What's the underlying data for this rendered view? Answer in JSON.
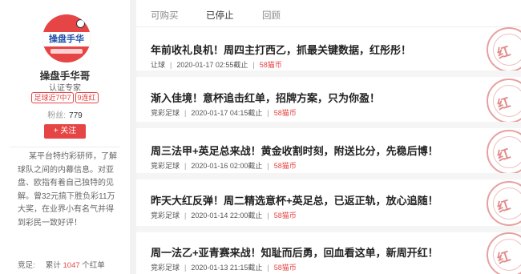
{
  "profile": {
    "avatar_text": "操盘手华",
    "name": "操盘手华哥",
    "cert": "认证专家",
    "tags": [
      "足球近7中7",
      "9连红"
    ],
    "fans_label": "粉丝:",
    "fans_count": "779",
    "follow_label": "+ 关注",
    "description": "某平台特约彩研师，了解球队之间的内幕信息。对亚盘、欧指有着自己独特的见解。曾32元搞下胜负彩11万大奖，在业界小有名气并得到彩民一致好评！",
    "result_label": "竞足:",
    "result_prefix": "累计",
    "result_count": "1047",
    "result_suffix": "个红单"
  },
  "tabs": [
    {
      "label": "可购买",
      "active": false
    },
    {
      "label": "已停止",
      "active": true
    },
    {
      "label": "回顾",
      "active": false
    }
  ],
  "stamp_char": "红",
  "items": [
    {
      "title": "年前收礼良机！周四主打西乙，抓最关键数据，红彤彤！",
      "type": "让球",
      "time": "2020-01-17 02:55截止",
      "price": "58猫币"
    },
    {
      "title": "渐入佳境！意杯追击红单，招牌方案，只为你盈！",
      "type": "竞彩足球",
      "time": "2020-01-17 04:15截止",
      "price": "58猫币"
    },
    {
      "title": "周三法甲+英足总来战！黄金收割时刻，附送比分，先稳后博！",
      "type": "竞彩足球",
      "time": "2020-01-16 02:00截止",
      "price": "58猫币"
    },
    {
      "title": "昨天大红反弹！周二精选意杯+英足总，已返正轨，放心追随！",
      "type": "竞彩足球",
      "time": "2020-01-14 22:00截止",
      "price": "58猫币"
    },
    {
      "title": "周一法乙+亚青赛来战！知耻而后勇，回血看这单，新周开红！",
      "type": "竞彩足球",
      "time": "2020-01-13 21:15截止",
      "price": "58猫币"
    }
  ]
}
